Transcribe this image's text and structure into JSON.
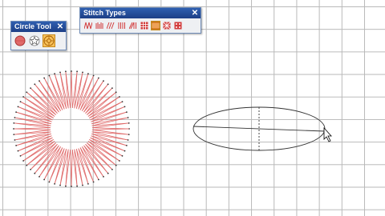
{
  "circle_tool": {
    "title": "Circle Tool",
    "tools": [
      {
        "icon": "red-filled-circle-icon",
        "active": false
      },
      {
        "icon": "star-icon",
        "active": false
      },
      {
        "icon": "starburst-circle-icon",
        "active": true
      }
    ]
  },
  "stitch_types": {
    "title": "Stitch Types",
    "tools": [
      {
        "icon": "satin-zigzag-stitch-icon",
        "active": false
      },
      {
        "icon": "satin-wave-stitch-icon",
        "active": false
      },
      {
        "icon": "satin-diagonal-stitch-icon",
        "active": false
      },
      {
        "icon": "satin-vertical-stitch-icon",
        "active": false
      },
      {
        "icon": "satin-mixed-stitch-icon",
        "active": false
      },
      {
        "icon": "fill-grid-stitch-icon",
        "active": false
      },
      {
        "icon": "fill-pattern-stitch-icon",
        "active": true
      },
      {
        "icon": "fill-cross-stitch-icon",
        "active": false
      },
      {
        "icon": "fill-dotted-stitch-icon",
        "active": false
      }
    ]
  },
  "colors": {
    "stitch_red": "#e06a6a",
    "stitch_dark": "#333333",
    "grid": "#b9b9b9",
    "active_tool": "#f7c15a",
    "titlebar": "#2f5fb0"
  }
}
